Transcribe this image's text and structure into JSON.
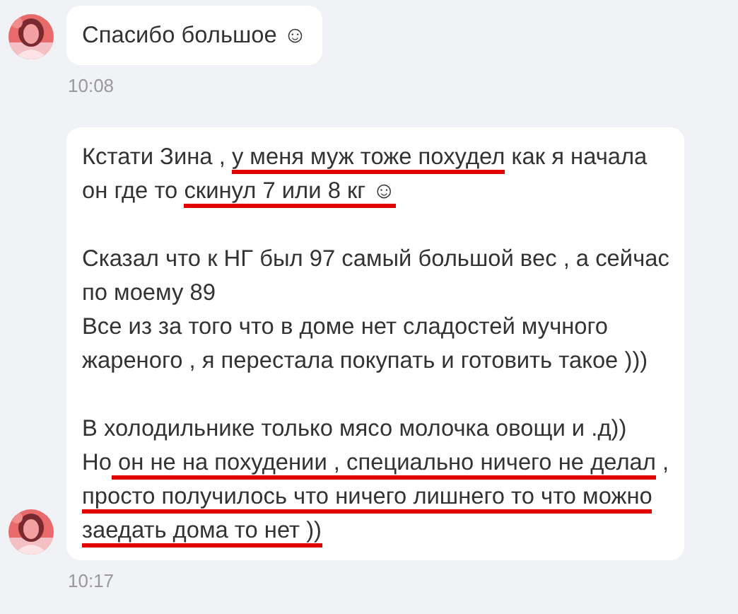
{
  "messages": [
    {
      "time": "10:08",
      "lines": [
        {
          "kind": "text",
          "segments": [
            {
              "text": "Спасибо большое ☺",
              "underlined": false
            }
          ]
        }
      ]
    },
    {
      "time": "10:17",
      "lines": [
        {
          "kind": "text",
          "segments": [
            {
              "text": "Кстати Зина , ",
              "underlined": false
            },
            {
              "text": "у меня муж тоже похудел",
              "underlined": true
            },
            {
              "text": " как я начала",
              "underlined": false
            }
          ]
        },
        {
          "kind": "text",
          "segments": [
            {
              "text": "он где то ",
              "underlined": false
            },
            {
              "text": "скинул 7 или 8 кг ☺",
              "underlined": true
            }
          ]
        },
        {
          "kind": "gap"
        },
        {
          "kind": "text",
          "segments": [
            {
              "text": "Сказал что к НГ был 97 самый большой вес , а сейчас",
              "underlined": false
            }
          ]
        },
        {
          "kind": "text",
          "segments": [
            {
              "text": "по моему 89",
              "underlined": false
            }
          ]
        },
        {
          "kind": "text",
          "segments": [
            {
              "text": "Все из за того что в доме нет сладостей мучного",
              "underlined": false
            }
          ]
        },
        {
          "kind": "text",
          "segments": [
            {
              "text": "жареного , я перестала покупать и готовить такое )))",
              "underlined": false
            }
          ]
        },
        {
          "kind": "gap"
        },
        {
          "kind": "text",
          "segments": [
            {
              "text": "В холодильнике только мясо молочка овощи и .д))",
              "underlined": false
            }
          ]
        },
        {
          "kind": "text",
          "segments": [
            {
              "text": "Но",
              "underlined": false
            },
            {
              "text": " он не на похудении , специально ничего не делал",
              "underlined": true
            },
            {
              "text": " ,",
              "underlined": false
            }
          ]
        },
        {
          "kind": "text",
          "segments": [
            {
              "text": "просто получилось что ничего лишнего то что можно",
              "underlined": true
            }
          ]
        },
        {
          "kind": "text",
          "segments": [
            {
              "text": "заедать дома то нет ))",
              "underlined": true
            }
          ]
        }
      ]
    }
  ]
}
